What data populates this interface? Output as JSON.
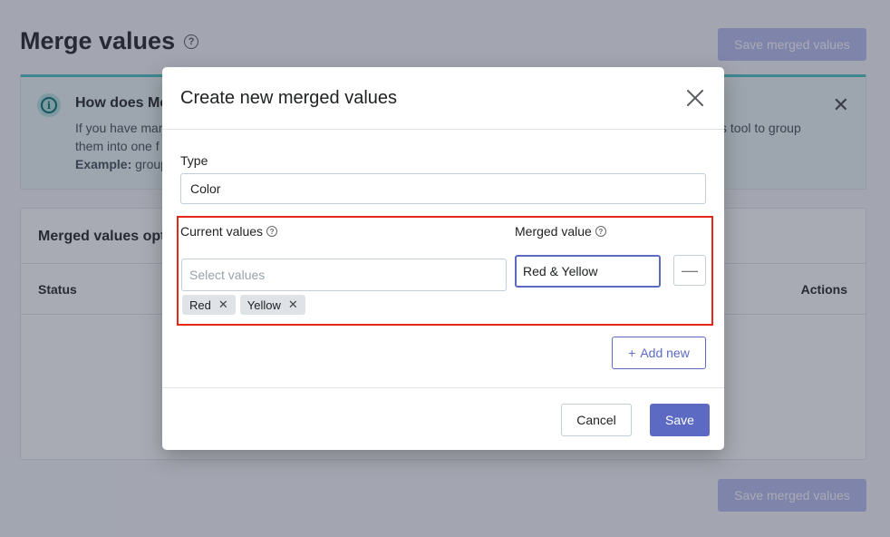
{
  "page": {
    "title": "Merge values",
    "save_merged_label": "Save merged values",
    "banner": {
      "title": "How does Me",
      "text_line1": "If you have mar",
      "text_line1_right": "s tool to group",
      "text_line2": "them into one f",
      "text_line3_bold": "Example:",
      "text_line3": " group"
    },
    "card": {
      "title": "Merged values opt",
      "col_status": "Status",
      "col_actions": "Actions"
    }
  },
  "modal": {
    "title": "Create new merged values",
    "type_label": "Type",
    "type_value": "Color",
    "current_values_label": "Current values",
    "select_placeholder": "Select values",
    "tags": [
      "Red",
      "Yellow"
    ],
    "merged_value_label": "Merged value",
    "merged_value": "Red & Yellow",
    "add_new_label": "Add new",
    "cancel_label": "Cancel",
    "save_label": "Save"
  },
  "colors": {
    "primary": "#5c6ac4",
    "highlight": "#e4261b",
    "banner_accent": "#47c1bf"
  }
}
